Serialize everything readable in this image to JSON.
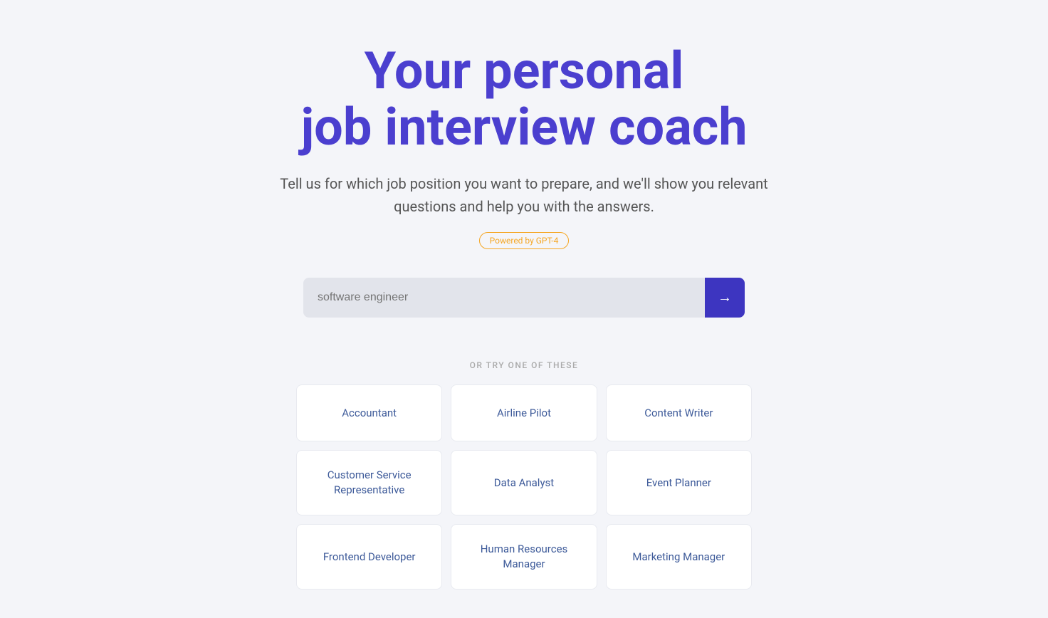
{
  "hero": {
    "title_line1": "Your personal",
    "title_line2": "job interview coach",
    "subtitle": "Tell us for which job position you want to prepare, and we'll show you relevant questions and help you with the answers.",
    "powered_label": "Powered by GPT-4"
  },
  "search": {
    "placeholder": "software engineer",
    "button_label": "→"
  },
  "suggestions": {
    "label": "OR TRY ONE OF THESE",
    "items": [
      {
        "id": "accountant",
        "label": "Accountant"
      },
      {
        "id": "airline-pilot",
        "label": "Airline Pilot"
      },
      {
        "id": "content-writer",
        "label": "Content Writer"
      },
      {
        "id": "customer-service-rep",
        "label": "Customer Service Representative"
      },
      {
        "id": "data-analyst",
        "label": "Data Analyst"
      },
      {
        "id": "event-planner",
        "label": "Event Planner"
      },
      {
        "id": "frontend-developer",
        "label": "Frontend Developer"
      },
      {
        "id": "hr-manager",
        "label": "Human Resources Manager"
      },
      {
        "id": "marketing-manager",
        "label": "Marketing Manager"
      }
    ]
  }
}
